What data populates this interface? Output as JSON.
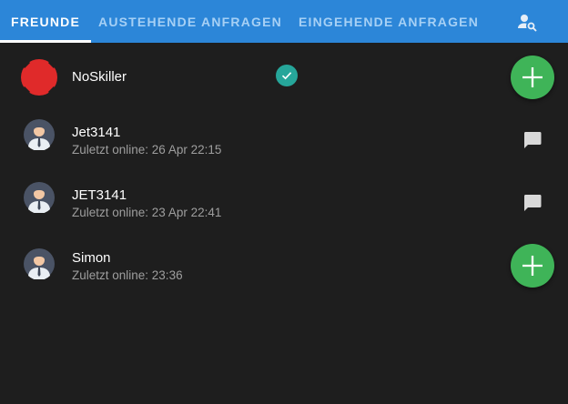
{
  "tabs": [
    {
      "label": "FREUNDE",
      "active": true
    },
    {
      "label": "AUSTEHENDE ANFRAGEN",
      "active": false
    },
    {
      "label": "EINGEHENDE ANFRAGEN",
      "active": false
    }
  ],
  "toolbar": {
    "search_icon": "person-search-icon"
  },
  "friends": [
    {
      "name": "NoSkiller",
      "status": "",
      "avatar": "red-avatar",
      "verified": true,
      "action": "add"
    },
    {
      "name": "Jet3141",
      "status": "Zuletzt online: 26 Apr 22:15",
      "avatar": "businessman-avatar",
      "action": "chat"
    },
    {
      "name": "JET3141",
      "status": "Zuletzt online: 23 Apr 22:41",
      "avatar": "businessman-avatar",
      "action": "chat"
    },
    {
      "name": "Simon",
      "status": "Zuletzt online: 23:36",
      "avatar": "businessman-avatar",
      "action": "add"
    }
  ],
  "colors": {
    "tabbar": "#2c86d8",
    "background": "#1e1e1e",
    "add_button": "#3fb458",
    "verified": "#26a69a"
  }
}
